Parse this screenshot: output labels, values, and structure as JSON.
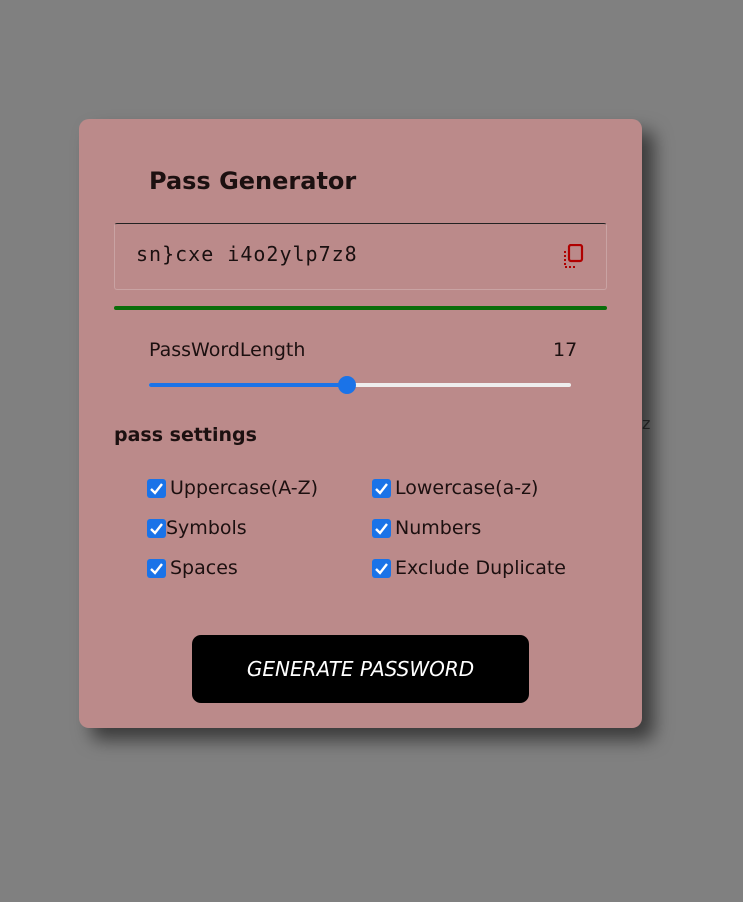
{
  "background_stray_text": "z",
  "card": {
    "title": "Pass Generator",
    "password": "sn}cxe i4o2ylp7z8",
    "copy_icon": "copy-icon",
    "strength_color": "#0a6d0a",
    "length_label": "PassWordLength",
    "length_value": "17",
    "length_fraction": 0.47,
    "settings_heading": "pass settings",
    "options": [
      {
        "label": "Uppercase(A-Z)",
        "checked": true
      },
      {
        "label": "Lowercase(a-z)",
        "checked": true
      },
      {
        "label": "Symbols",
        "checked": true
      },
      {
        "label": "Numbers",
        "checked": true
      },
      {
        "label": "Spaces",
        "checked": true
      },
      {
        "label": "Exclude Duplicate",
        "checked": true
      }
    ],
    "generate_label": "GENERATE PASSWORD"
  },
  "colors": {
    "page_bg": "#808080",
    "card_bg": "#bb8a8a",
    "accent": "#1a73e8",
    "copy_icon": "#b00000",
    "button_bg": "#000000"
  }
}
